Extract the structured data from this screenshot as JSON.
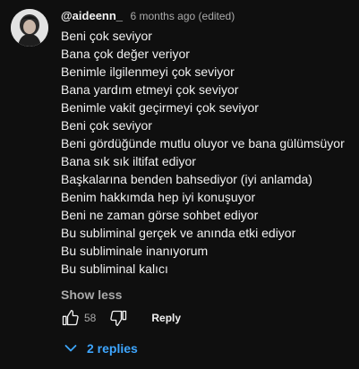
{
  "comment": {
    "author": "@aideenn_",
    "time": "6 months ago (edited)",
    "lines": [
      "Beni çok seviyor",
      "Bana çok değer veriyor",
      "Benimle ilgilenmeyi çok seviyor",
      "Bana yardım etmeyi çok seviyor",
      "Benimle vakit geçirmeyi çok seviyor",
      "Beni çok seviyor",
      "Beni gördüğünde mutlu oluyor ve bana gülümsüyor",
      "Bana sık sık iltifat ediyor",
      "Başkalarına benden bahsediyor (iyi anlamda)",
      "Benim hakkımda hep iyi konuşuyor",
      "Beni ne zaman görse sohbet ediyor",
      "Bu subliminal gerçek ve anında etki ediyor",
      "Bu subliminale inanıyorum",
      "Bu subliminal kalıcı"
    ],
    "show_less_label": "Show less",
    "like_count": "58",
    "reply_label": "Reply",
    "replies_label": "2 replies"
  },
  "icons": {
    "avatar": "avatar-image",
    "like": "thumbs-up-icon",
    "dislike": "thumbs-down-icon",
    "expand": "chevron-down-icon"
  },
  "colors": {
    "background": "#0f0f0f",
    "text": "#f1f1f1",
    "secondary": "#aaaaaa",
    "link": "#3ea6ff"
  }
}
